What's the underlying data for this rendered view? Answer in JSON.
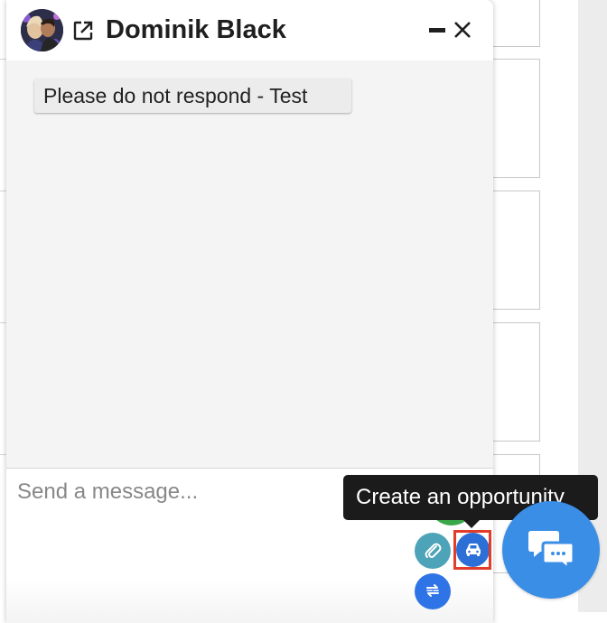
{
  "chat": {
    "contact_name": "Dominik Black",
    "messages": [
      {
        "text": "Please do not respond - Test"
      }
    ],
    "composer": {
      "placeholder": "Send a message..."
    }
  },
  "tooltip": {
    "text": "Create an opportunity"
  },
  "icons": {
    "header": [
      "avatar",
      "external-link-icon",
      "minimize-icon",
      "close-icon"
    ],
    "actions": [
      "attachment-icon",
      "car-icon",
      "transfer-icon"
    ],
    "launcher": "chat-bubble-icon"
  },
  "colors": {
    "highlight": "#e23c2a",
    "launcher": "#3a8ee6",
    "attach_button": "#4da3b8",
    "opportunity_button": "#2c6fd6",
    "transfer_button": "#2f74e6",
    "green_button": "#3aa84a",
    "tooltip_bg": "#1b1b1b"
  }
}
